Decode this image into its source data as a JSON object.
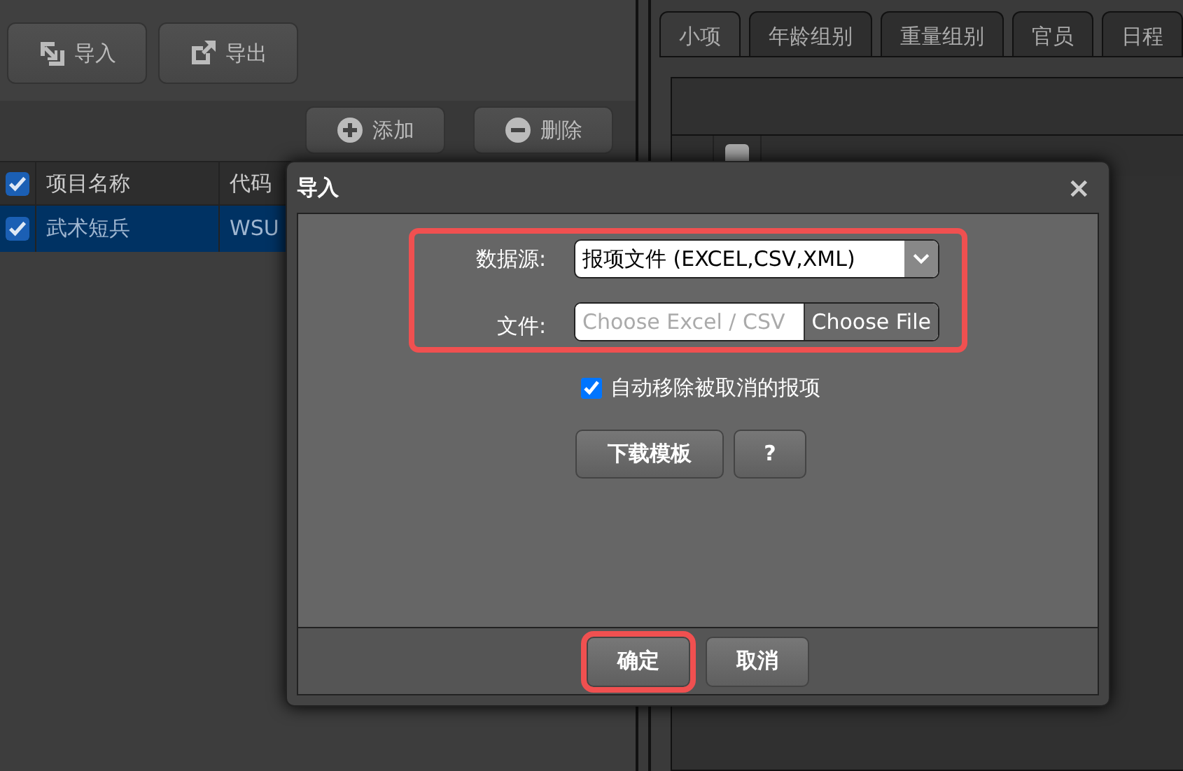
{
  "toolbar": {
    "buttons": [
      {
        "label": "导入",
        "kind": "import"
      },
      {
        "label": "导出",
        "kind": "export"
      }
    ]
  },
  "actions": [
    {
      "label": "添加",
      "kind": "add"
    },
    {
      "label": "删除",
      "kind": "remove"
    }
  ],
  "table": {
    "all_checked": true,
    "columns": [
      "项目名称",
      "代码"
    ],
    "rows": [
      {
        "checked": true,
        "selected": true,
        "cells": [
          "武术短兵",
          "WSU"
        ]
      }
    ]
  },
  "tabs": [
    {
      "label": "小项",
      "selected": true
    },
    {
      "label": "年龄组别",
      "selected": false
    },
    {
      "label": "重量组别",
      "selected": false
    },
    {
      "label": "官员",
      "selected": false
    },
    {
      "label": "日程",
      "selected": false
    }
  ],
  "sub_table": {
    "all_checked": false
  },
  "dialog": {
    "title": "导入",
    "close": "×",
    "highlighted_fields": true,
    "source": {
      "label": "数据源:",
      "value": "报项文件 (EXCEL,CSV,XML)"
    },
    "file": {
      "label": "文件:",
      "placeholder": "Choose Excel / CSV",
      "button": "Choose File"
    },
    "auto_remove": {
      "label": "自动移除被取消的报项",
      "checked": true
    },
    "tools": [
      "下载模板",
      "?"
    ],
    "buttons": [
      {
        "label": "确定",
        "highlighted": true
      },
      {
        "label": "取消",
        "highlighted": false
      }
    ]
  }
}
